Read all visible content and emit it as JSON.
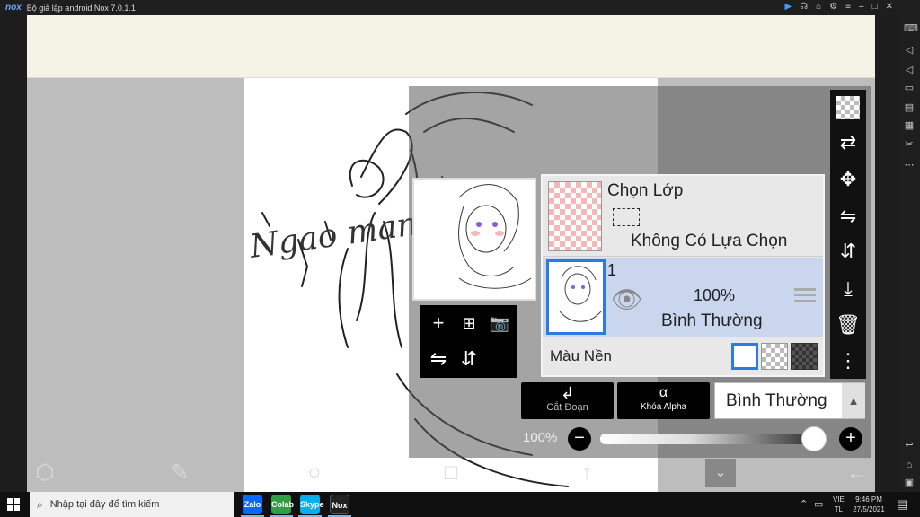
{
  "window": {
    "title": "Bộ giả lập android Nox 7.0.1.1",
    "logo": "nox"
  },
  "title_controls": [
    "play-icon",
    "headset-icon",
    "shirt-icon",
    "gear-icon",
    "menu-icon",
    "minimize-icon",
    "maximize-icon",
    "close-icon"
  ],
  "layers_panel": {
    "selection_layer": {
      "title": "Chọn Lớp",
      "status": "Không Có Lựa Chọn"
    },
    "layer_1": {
      "name": "1",
      "opacity": "100%",
      "blend": "Bình Thường"
    },
    "background": {
      "label": "Màu Nền"
    },
    "clipping_label": "Cắt Đoạn",
    "alpha_lock_label": "Khóa Alpha",
    "blend_mode": "Bình Thường",
    "opacity_value": "100%",
    "opacity_fraction": 1.0
  },
  "canvas": {
    "signature_text": "Ngao man"
  },
  "taskbar": {
    "search_placeholder": "Nhập tại đây để tìm kiếm",
    "apps": [
      "Zalo",
      "Colab",
      "Skype",
      "Nox"
    ],
    "lang_top": "VIE",
    "lang_bottom": "TL",
    "time": "9:46 PM",
    "date": "27/5/2021"
  },
  "colors": {
    "accent_blue": "#2d7be0",
    "layer_selected": "#c9d6ee",
    "panel_bg": "#e8e8e8"
  }
}
